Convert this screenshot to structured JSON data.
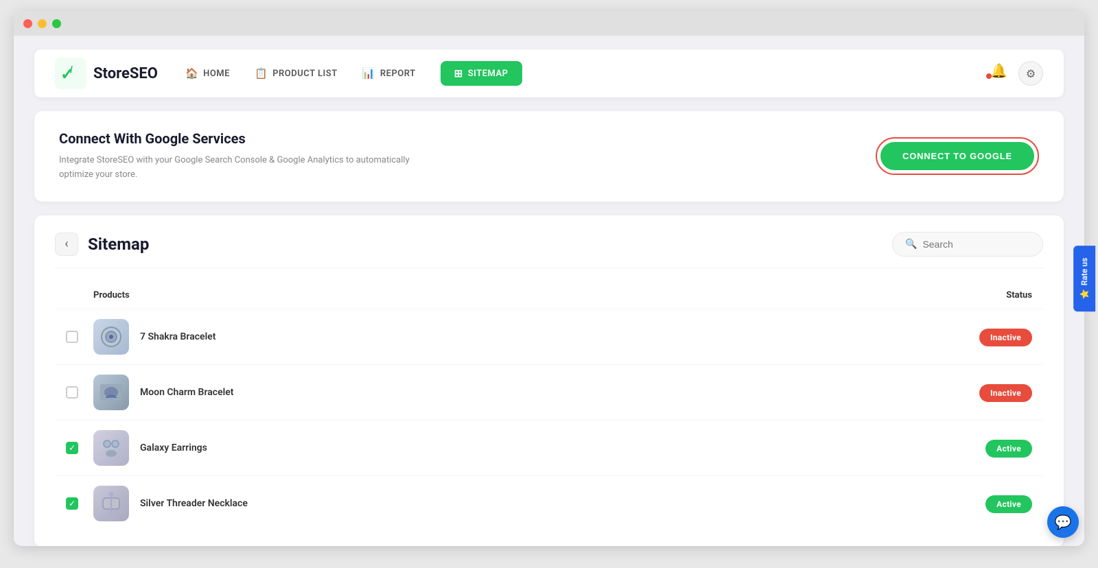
{
  "window": {
    "title": "StoreSEO"
  },
  "nav": {
    "logo_text": "StoreSEO",
    "links": [
      {
        "label": "HOME",
        "icon": "🏠",
        "active": false
      },
      {
        "label": "PRODUCT LIST",
        "icon": "📋",
        "active": false
      },
      {
        "label": "REPORT",
        "icon": "📊",
        "active": false
      },
      {
        "label": "SITEMAP",
        "icon": "⊞",
        "active": true
      }
    ],
    "settings_label": "⚙"
  },
  "google_card": {
    "title": "Connect With Google Services",
    "description": "Integrate StoreSEO with your Google Search Console & Google Analytics to automatically optimize your store.",
    "button_label": "CONNECT TO GOOGLE"
  },
  "sitemap": {
    "title": "Sitemap",
    "search_placeholder": "Search",
    "columns": {
      "products": "Products",
      "status": "Status"
    },
    "products": [
      {
        "id": 1,
        "name": "7 Shakra Bracelet",
        "status": "Inactive",
        "checked": false
      },
      {
        "id": 2,
        "name": "Moon Charm Bracelet",
        "status": "Inactive",
        "checked": false
      },
      {
        "id": 3,
        "name": "Galaxy Earrings",
        "status": "Active",
        "checked": true
      },
      {
        "id": 4,
        "name": "Silver Threader Necklace",
        "status": "Active",
        "checked": true
      }
    ]
  },
  "rate_us": {
    "label": "⭐ Rate us"
  },
  "colors": {
    "green": "#22c55e",
    "red": "#e74c3c",
    "blue": "#2563eb",
    "dark": "#1a1a2e"
  }
}
